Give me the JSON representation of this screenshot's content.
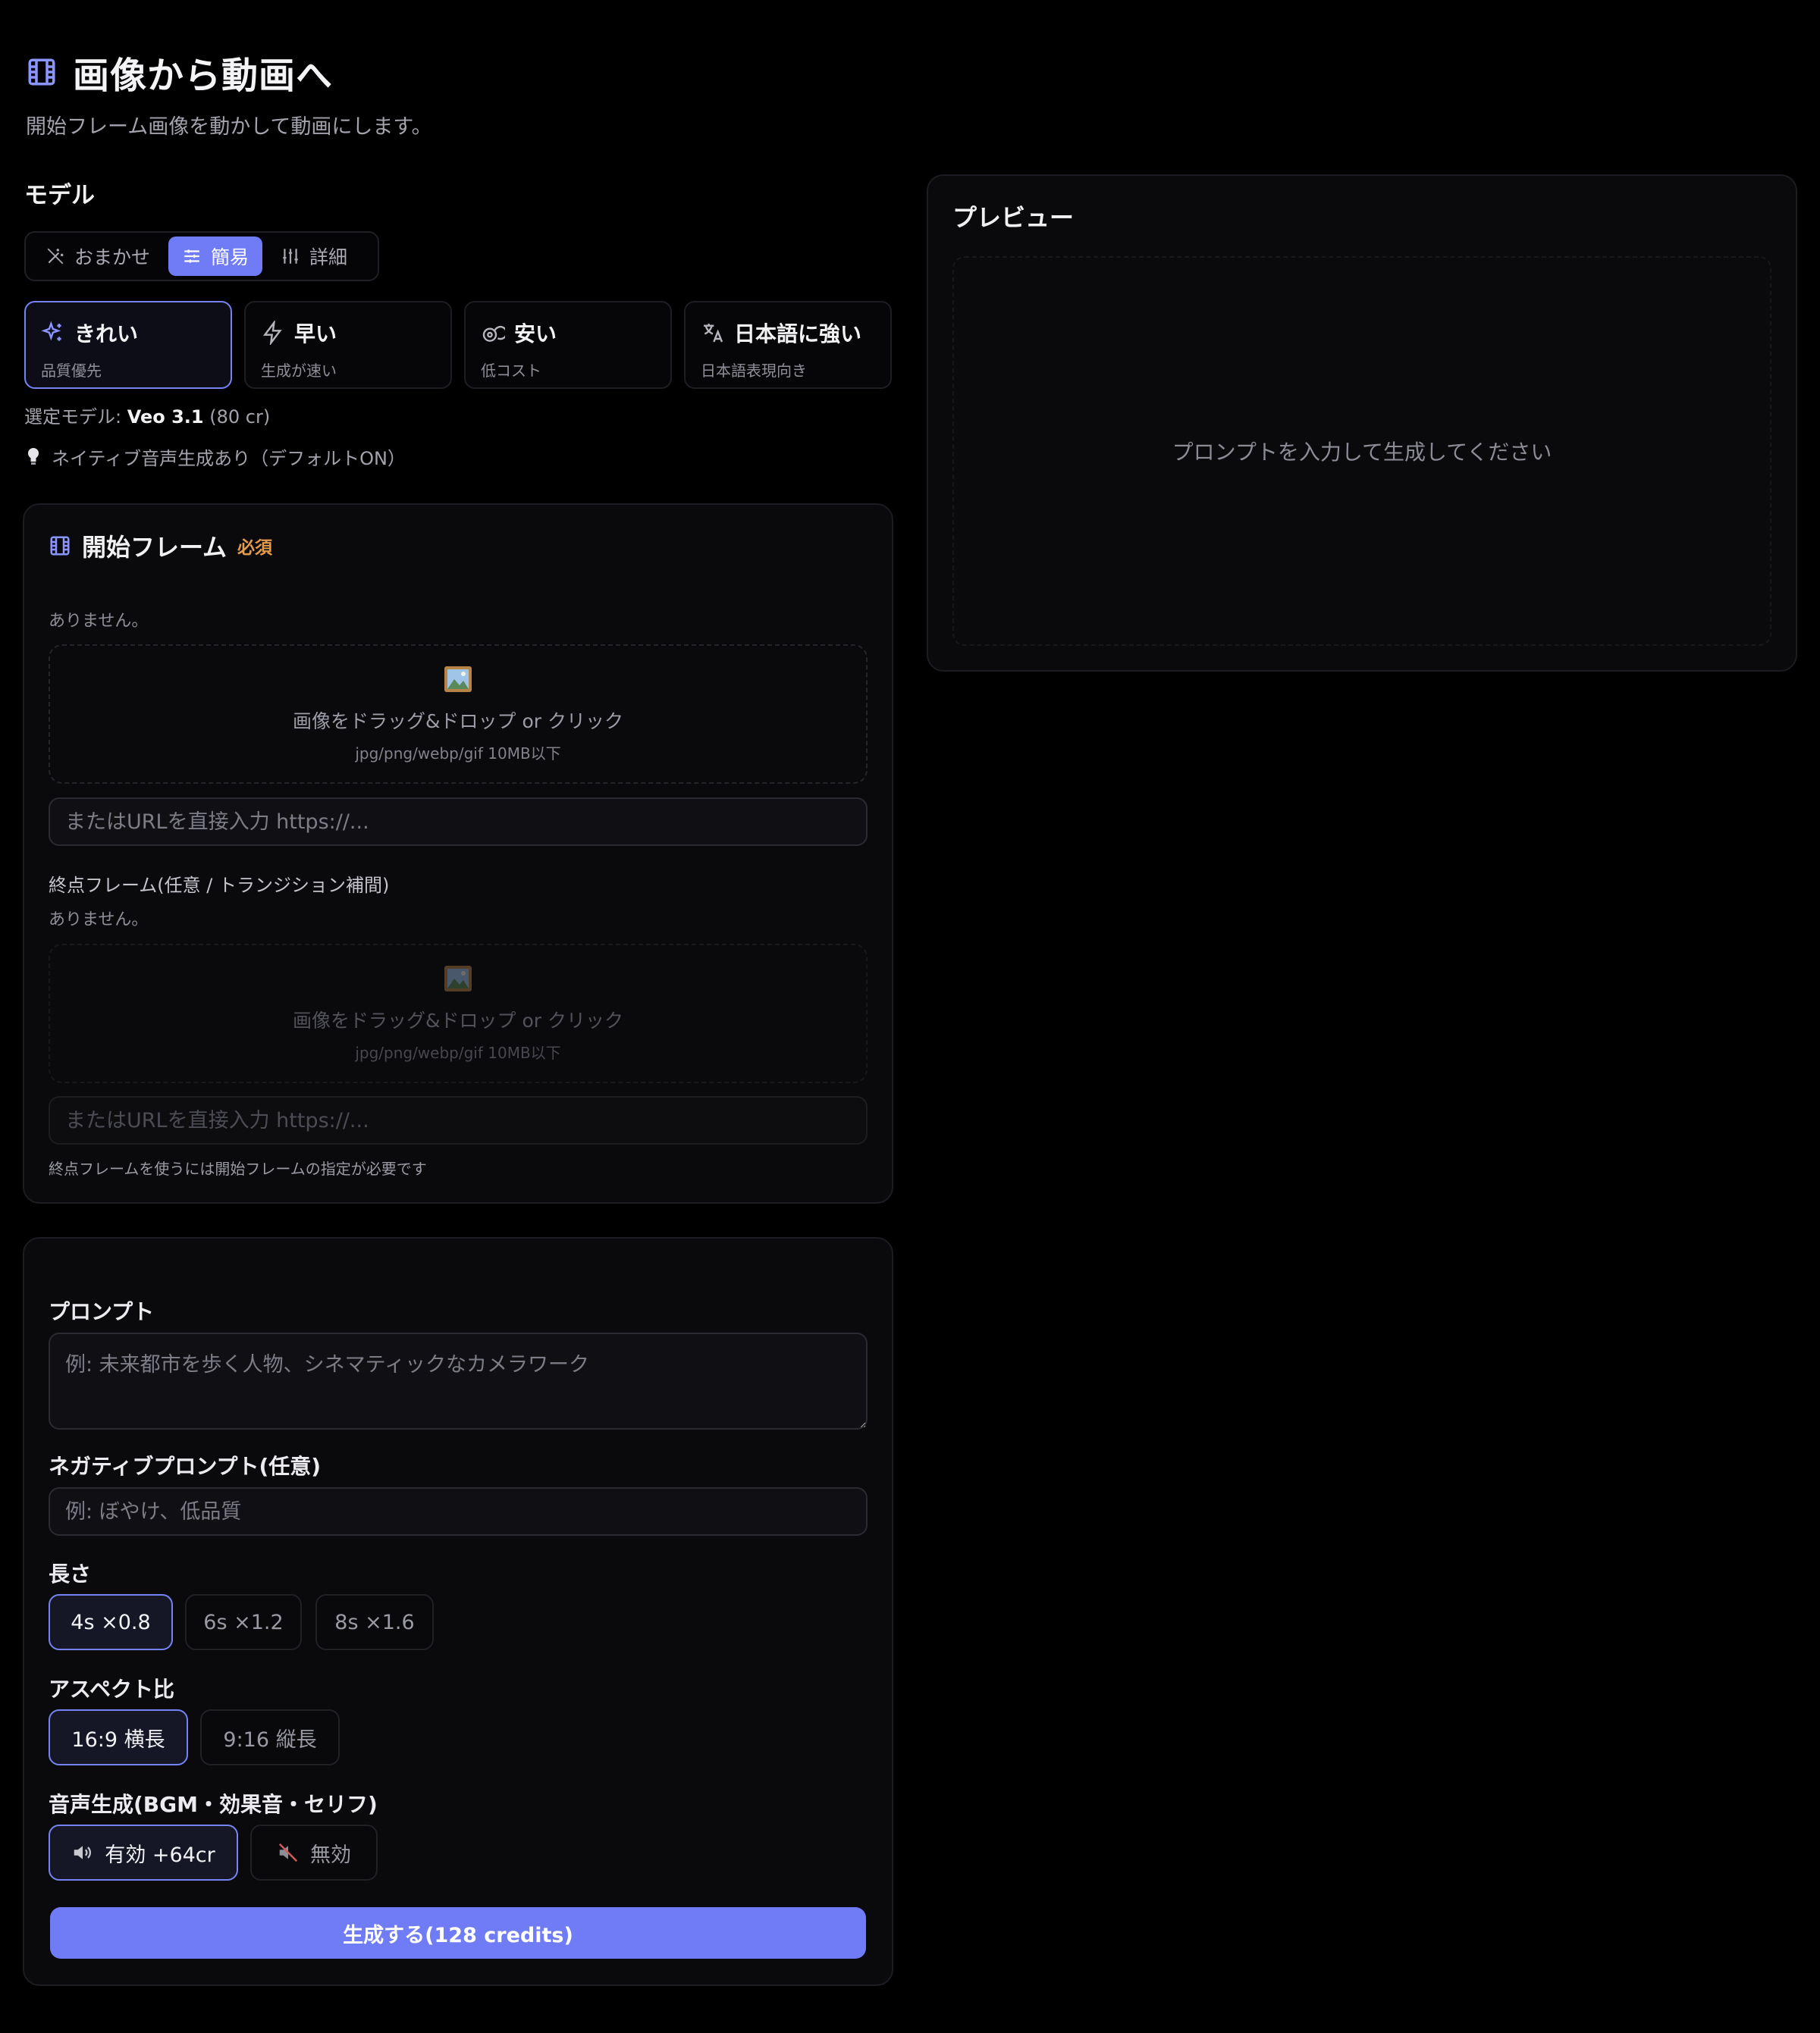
{
  "header": {
    "title": "画像から動画へ",
    "subtitle": "開始フレーム画像を動かして動画にします。"
  },
  "model": {
    "section_label": "モデル",
    "modes": [
      {
        "label": "おまかせ",
        "icon": "magic-wand-icon"
      },
      {
        "label": "簡易",
        "icon": "sliders-icon",
        "active": true
      },
      {
        "label": "詳細",
        "icon": "tuning-icon"
      }
    ],
    "presets": [
      {
        "title": "きれい",
        "sub": "品質優先",
        "icon": "sparkles-icon",
        "active": true
      },
      {
        "title": "早い",
        "sub": "生成が速い",
        "icon": "lightning-icon"
      },
      {
        "title": "安い",
        "sub": "低コスト",
        "icon": "coins-icon"
      },
      {
        "title": "日本語に強い",
        "sub": "日本語表現向き",
        "icon": "translate-icon"
      }
    ],
    "selected_prefix": "選定モデル: ",
    "selected_name": "Veo 3.1",
    "selected_cost": " (80 cr)",
    "hint": "ネイティブ音声生成あり（デフォルトON）"
  },
  "frames": {
    "start_title": "開始フレーム",
    "required": "必須",
    "start_none": "ありません。",
    "drop_main": "画像をドラッグ&ドロップ or クリック",
    "drop_sub": "jpg/png/webp/gif 10MB以下",
    "url_placeholder": "またはURLを直接入力 https://...",
    "end_label": "終点フレーム(任意 / トランジション補間)",
    "end_none": "ありません。",
    "end_note": "終点フレームを使うには開始フレームの指定が必要です"
  },
  "form": {
    "prompt_label": "プロンプト",
    "prompt_placeholder": "例: 未来都市を歩く人物、シネマティックなカメラワーク",
    "negative_label": "ネガティブプロンプト(任意)",
    "negative_placeholder": "例: ぼやけ、低品質",
    "length_label": "長さ",
    "lengths": [
      "4s ×0.8",
      "6s ×1.2",
      "8s ×1.6"
    ],
    "length_selected": 0,
    "aspect_label": "アスペクト比",
    "aspects": [
      "16:9 横長",
      "9:16 縦長"
    ],
    "aspect_selected": 0,
    "audio_label": "音声生成(BGM・効果音・セリフ)",
    "audio_on": "有効 +64cr",
    "audio_off": "無効",
    "generate_label": "生成する(128 credits)"
  },
  "preview": {
    "title": "プレビュー",
    "empty": "プロンプトを入力して生成してください"
  },
  "colors": {
    "accent": "#6f7cf6",
    "background": "#000000",
    "panel": "#0a0a0d",
    "required": "#e39a4b"
  }
}
